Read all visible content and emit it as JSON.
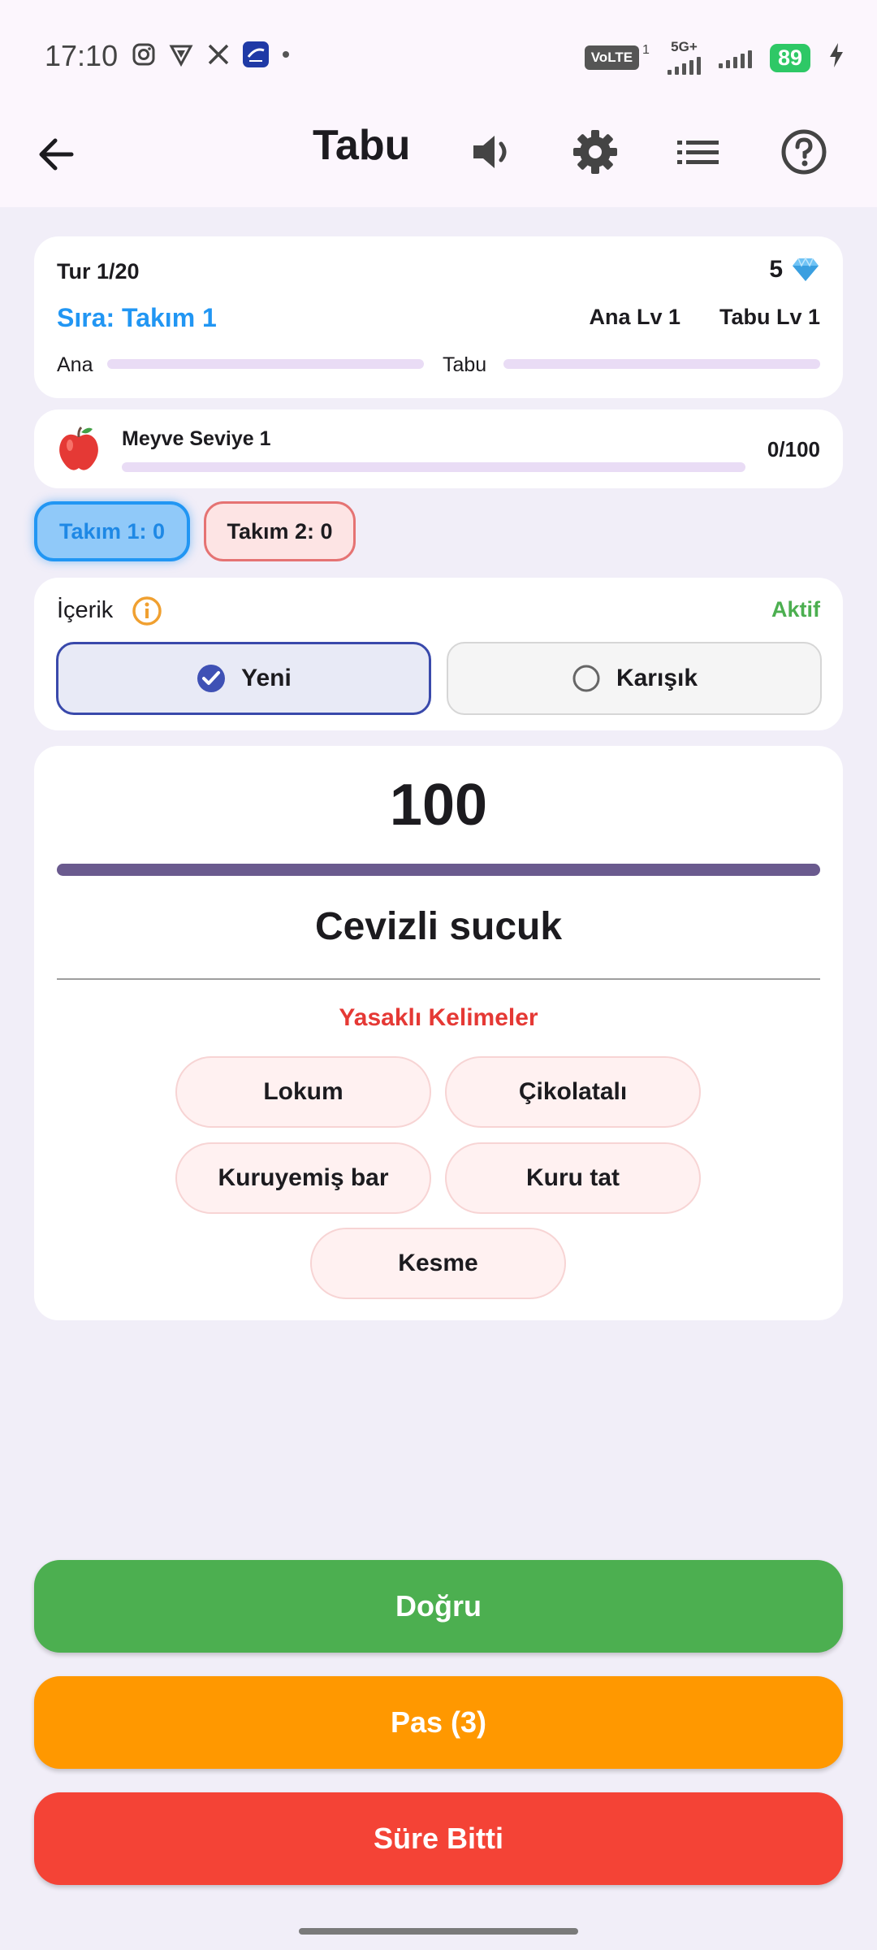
{
  "status_bar": {
    "time": "17:10",
    "volte": "VoLTE",
    "sim": "1",
    "network": "5G+",
    "battery": "89"
  },
  "app_bar": {
    "title": "Tabu"
  },
  "round_card": {
    "round": "Tur 1/20",
    "gems": "5",
    "turn": "Sıra: Takım 1",
    "ana_level": "Ana Lv 1",
    "tabu_level": "Tabu Lv 1",
    "ana_label": "Ana",
    "tabu_label": "Tabu",
    "ana_progress": 0,
    "tabu_progress": 0
  },
  "category_card": {
    "emoji": "🍎",
    "label": "Meyve Seviye 1",
    "score": "0/100",
    "progress": 0
  },
  "teams": [
    {
      "label": "Takım 1: 0",
      "active": true
    },
    {
      "label": "Takım 2: 0",
      "active": false
    }
  ],
  "content_card": {
    "label": "İçerik",
    "status": "Aktif",
    "options": [
      {
        "label": "Yeni",
        "selected": true
      },
      {
        "label": "Karışık",
        "selected": false
      }
    ]
  },
  "word_card": {
    "points": "100",
    "timer_progress": 1.0,
    "word": "Cevizli sucuk",
    "forbidden_title": "Yasaklı Kelimeler",
    "forbidden_words": [
      "Lokum",
      "Çikolatalı",
      "Kuruyemiş bar",
      "Kuru tat",
      "Kesme"
    ]
  },
  "actions": {
    "correct": "Doğru",
    "pass": "Pas (3)",
    "time_up": "Süre Bitti"
  },
  "colors": {
    "correct": "#4caf50",
    "pass": "#ff9800",
    "time_up": "#f44336",
    "accent_blue": "#2196f3",
    "forbidden_red": "#e53935",
    "timer_bar": "#6a5a8e",
    "active_green": "#4caf50"
  }
}
